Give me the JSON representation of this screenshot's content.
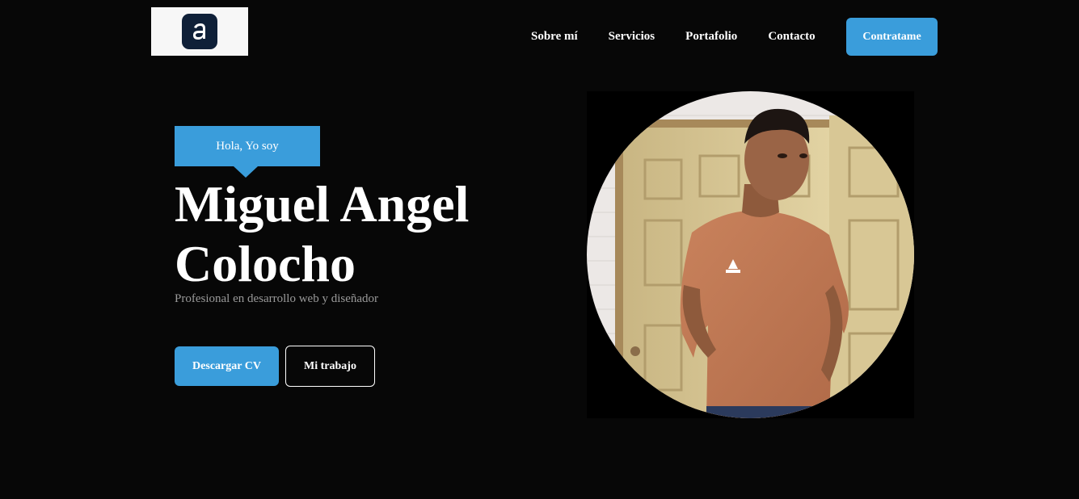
{
  "header": {
    "logo_icon": "letter-a-app-icon",
    "nav": {
      "about": "Sobre mí",
      "services": "Servicios",
      "portfolio": "Portafolio",
      "contact": "Contacto"
    },
    "cta_label": "Contratame"
  },
  "hero": {
    "greeting": "Hola, Yo soy",
    "name_line1": "Miguel Angel",
    "name_line2": "Colocho",
    "subtitle": "Profesional en desarrollo web y diseñador",
    "download_cv": "Descargar CV",
    "my_work": "Mi trabajo"
  },
  "portrait": {
    "subject": "young man in salmon t-shirt standing in front of a wooden door"
  },
  "colors": {
    "background": "#070707",
    "accent": "#3a9ddb",
    "text": "#ffffff",
    "muted": "#9a9a9a"
  }
}
